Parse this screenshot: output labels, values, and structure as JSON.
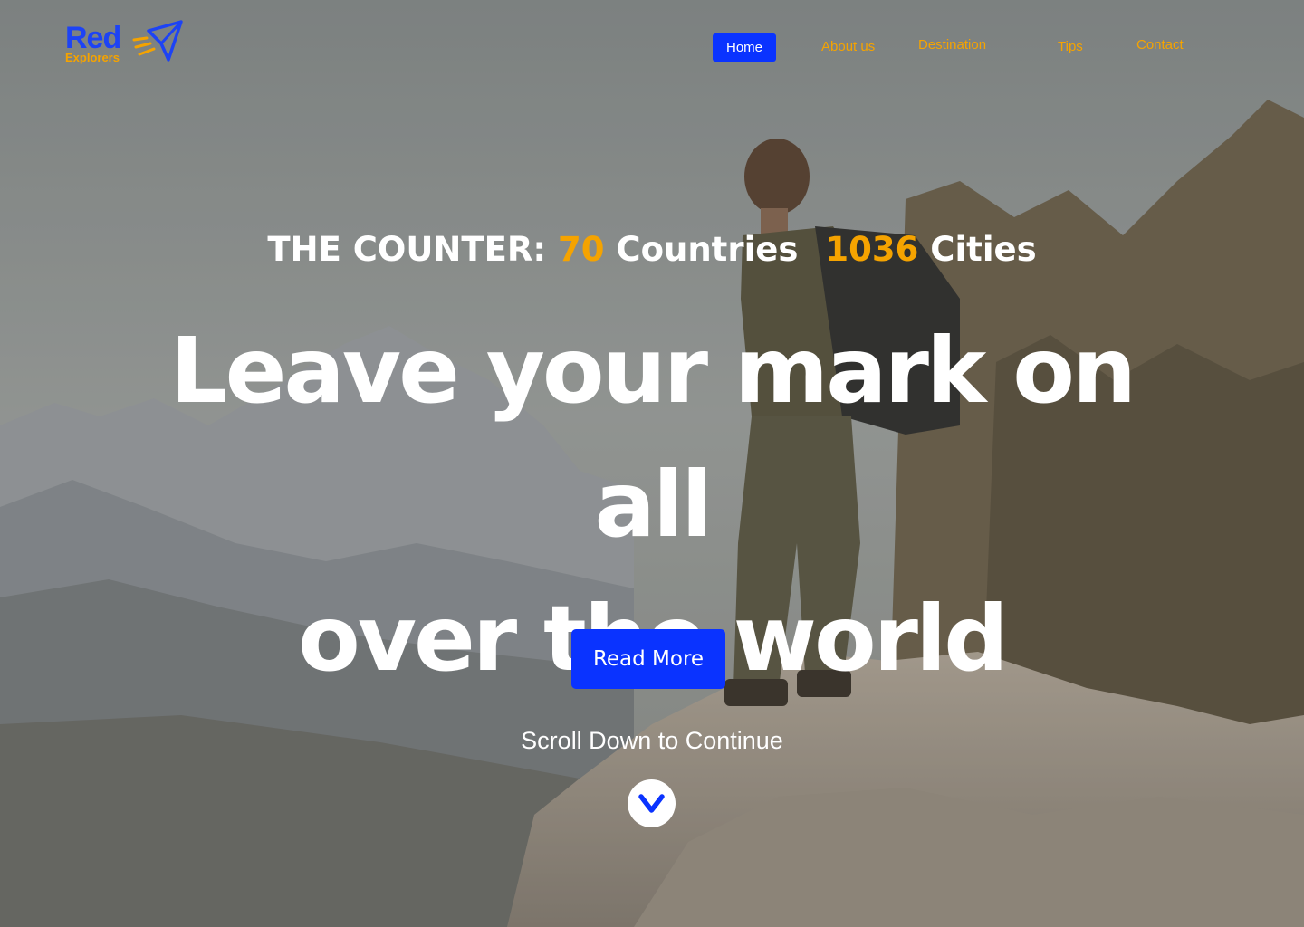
{
  "brand": {
    "name": "Red",
    "tagline": "Explorers",
    "icon": "paper-plane-icon",
    "colors": {
      "blue": "#0a33ff",
      "orange": "#f5a300"
    }
  },
  "nav": {
    "items": [
      {
        "label": "Home",
        "active": true
      },
      {
        "label": "About us"
      },
      {
        "label": "Destination"
      },
      {
        "label": "Tips"
      },
      {
        "label": "Contact"
      }
    ]
  },
  "counter": {
    "label": "THE COUNTER:",
    "countries_value": "70",
    "countries_label": "Countries",
    "cities_value": "1036",
    "cities_label": "Cities"
  },
  "hero": {
    "headline_line1": "Leave your mark on all",
    "headline_line2": "over the world",
    "button_label": "Read More",
    "scroll_text": "Scroll Down to Continue",
    "scroll_icon": "chevron-down-icon"
  }
}
